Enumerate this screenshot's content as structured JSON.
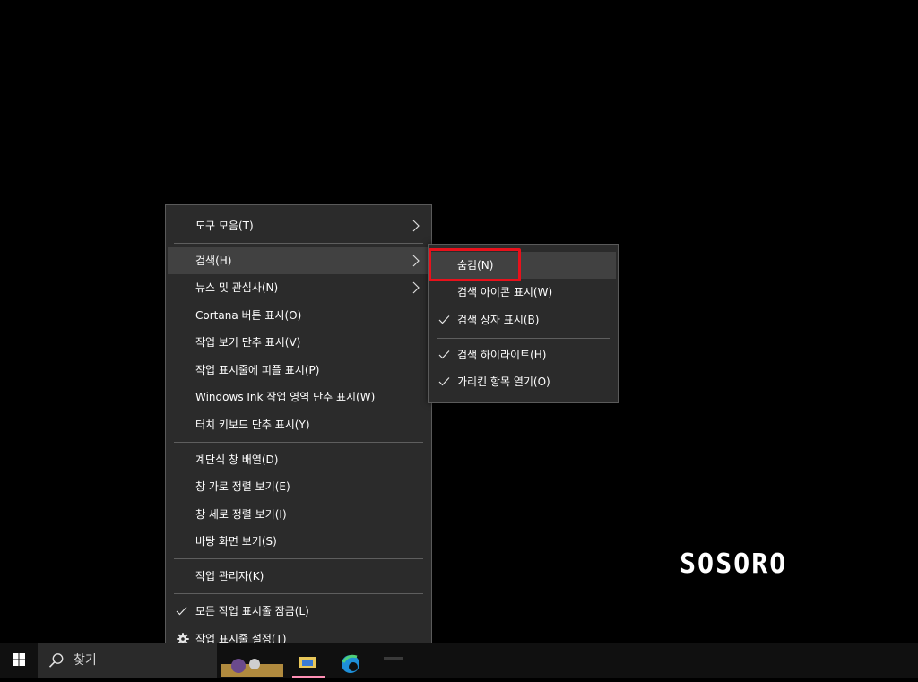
{
  "main_menu": {
    "items": [
      {
        "label": "도구 모음(T)",
        "submenu": true
      },
      {
        "label": "검색(H)",
        "submenu": true
      },
      {
        "label": "뉴스 및 관심사(N)",
        "submenu": true
      },
      {
        "label": "Cortana 버튼 표시(O)"
      },
      {
        "label": "작업 보기 단추 표시(V)"
      },
      {
        "label": "작업 표시줄에 피플 표시(P)"
      },
      {
        "label": "Windows Ink 작업 영역 단추 표시(W)"
      },
      {
        "label": "터치 키보드 단추 표시(Y)"
      },
      {
        "label": "계단식 창 배열(D)"
      },
      {
        "label": "창 가로 정렬 보기(E)"
      },
      {
        "label": "창 세로 정렬 보기(I)"
      },
      {
        "label": "바탕 화면 보기(S)"
      },
      {
        "label": "작업 관리자(K)"
      },
      {
        "label": "모든 작업 표시줄 잠금(L)",
        "checked": true
      },
      {
        "label": "작업 표시줄 설정(T)",
        "icon": "gear-icon"
      }
    ]
  },
  "search_submenu": {
    "items": [
      {
        "label": "숨김(N)",
        "checked": false
      },
      {
        "label": "검색 아이콘 표시(W)",
        "checked": false
      },
      {
        "label": "검색 상자 표시(B)",
        "checked": true
      },
      {
        "label": "검색 하이라이트(H)",
        "checked": true
      },
      {
        "label": "가리킨 항목 열기(O)",
        "checked": true
      }
    ]
  },
  "taskbar": {
    "search_text": "찾기",
    "start_icon": "windows-logo-icon",
    "search_icon": "search-icon"
  },
  "watermark": {
    "text": "SOSORO"
  },
  "colors": {
    "menu_bg": "#2b2b2b",
    "menu_hover": "#414141",
    "highlight_border": "#e8111b",
    "taskbar_bg": "#101010"
  }
}
